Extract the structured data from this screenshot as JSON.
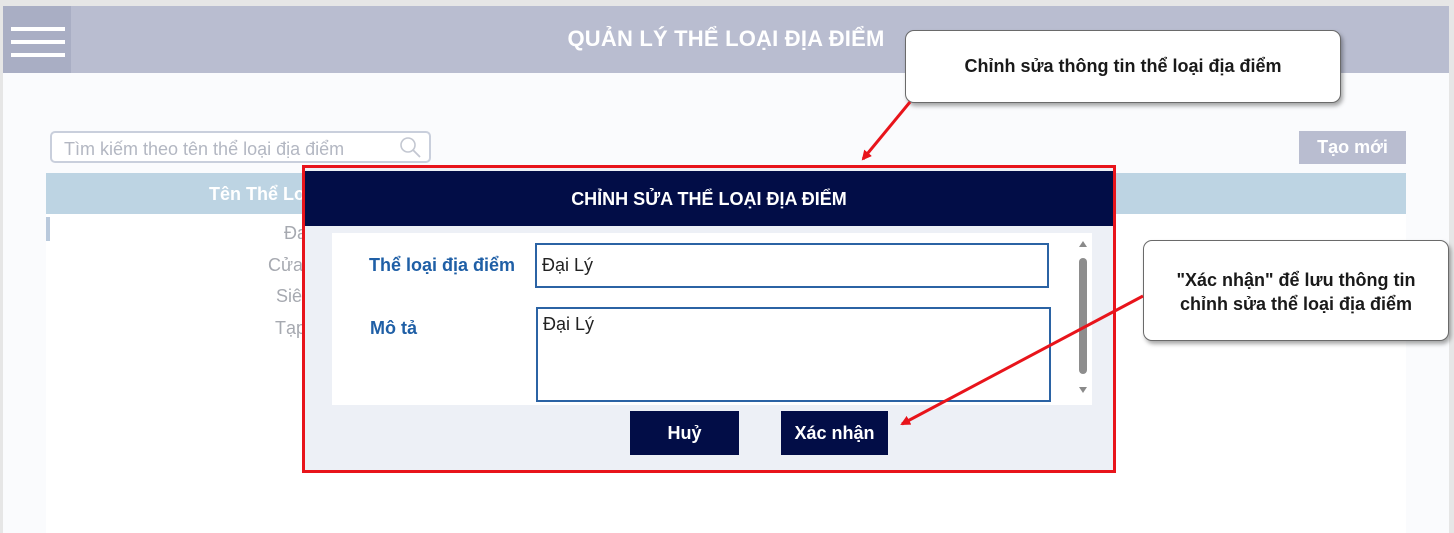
{
  "header": {
    "title": "QUẢN LÝ THỂ LOẠI ĐỊA ĐIỂM"
  },
  "toolbar": {
    "search_placeholder": "Tìm kiếm theo tên thể loại địa điểm",
    "create_label": "Tạo mới"
  },
  "table": {
    "column_header": "Tên Thể Lo",
    "rows": [
      "Đa",
      "Cửa",
      "Siê",
      "Tạp"
    ]
  },
  "modal": {
    "title": "CHỈNH SỬA THỂ LOẠI ĐỊA ĐIỂM",
    "category_label": "Thể loại địa điểm",
    "category_value": "Đại Lý",
    "description_label": "Mô tả",
    "description_value": "Đại Lý",
    "cancel_label": "Huỷ",
    "confirm_label": "Xác nhận"
  },
  "callouts": {
    "edit_info": "Chỉnh sửa thông tin thể loại địa điểm",
    "confirm_line1": "\"Xác nhận\" để lưu thông tin",
    "confirm_line2": "chỉnh sửa thể loại địa điểm"
  },
  "colors": {
    "header_bg": "#b9bdd0",
    "modal_header": "#020d47",
    "highlight_border": "#e8141b",
    "label_blue": "#1f5fa6"
  }
}
